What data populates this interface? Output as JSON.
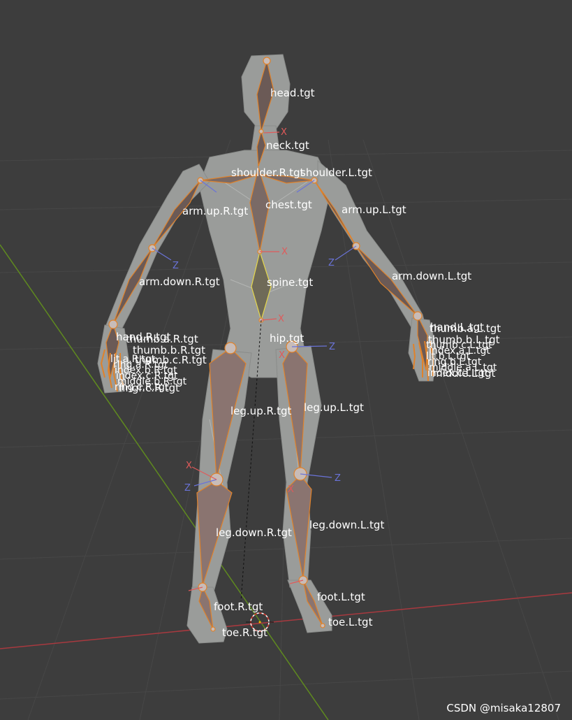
{
  "viewport": {
    "background": "#3d3d3d",
    "grid_color": "#474747",
    "x_axis_color": "#a8393f",
    "y_axis_color": "#5f8a1f",
    "mesh_color": "#9a9c9a",
    "bone_color": "#e0822a",
    "selected_bone_color": "#e6d84b"
  },
  "bones": {
    "head": "head.tgt",
    "neck": "neck.tgt",
    "shoulder_r": "shoulder.R.tgt",
    "shoulder_l": "shoulder.L.tgt",
    "chest": "chest.tgt",
    "arm_up_r": "arm.up.R.tgt",
    "arm_up_l": "arm.up.L.tgt",
    "arm_down_r": "arm.down.R.tgt",
    "arm_down_l": "arm.down.L.tgt",
    "spine": "spine.tgt",
    "hand_r": "hand.R.tgt",
    "hand_l": "hand.L.tgt",
    "thumb_a_r": "thumb.a.R.tgt",
    "thumb_a_l": "thumb.a.L.tgt",
    "thumb_b_r": "thumb.b.R.tgt",
    "thumb_b_l": "thumb.b.L.tgt",
    "thumb_c_r": "thumb.c.R.tgt",
    "hip": "hip.tgt",
    "leg_up_r": "leg.up.R.tgt",
    "leg_up_l": "leg.up.L.tgt",
    "leg_down_r": "leg.down.R.tgt",
    "leg_down_l": "leg.down.L.tgt",
    "foot_r": "foot.R.tgt",
    "foot_l": "foot.L.tgt",
    "toe_r": "toe.R.tgt",
    "toe_l": "toe.L.tgt",
    "middle_l": "middle.L.tgt",
    "finger_r": "fingr.c.R.tgt"
  },
  "finger_stack_r": [
    "lit.a.R.tgt",
    "ring.a.R.tgt",
    "index.b.R.tgt",
    "index.c.R.tgt",
    "middle.b.R.tgt",
    "ring.c.R.tgt"
  ],
  "finger_stack_l": [
    "thumb.c.L.tgt",
    "index.a.L.tgt",
    "lit.b.L.tgt",
    "ring.b.L.tgt",
    "middle.a.L.tgt",
    "index.c.L.tgt"
  ],
  "axes": {
    "x": "X",
    "y": "Y",
    "z": "Z"
  },
  "watermark": "CSDN @misaka12807"
}
